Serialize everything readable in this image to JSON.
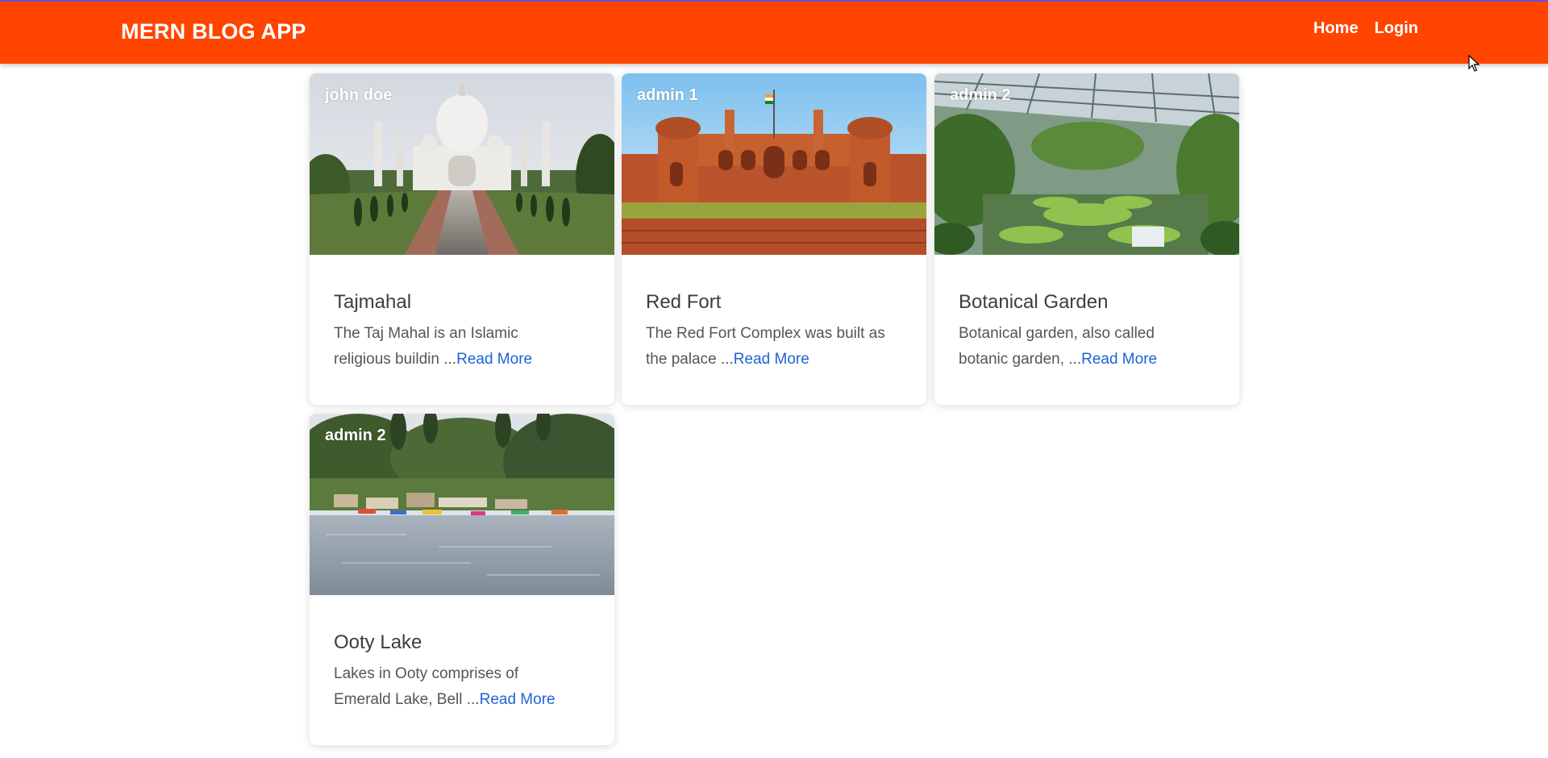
{
  "navbar": {
    "brand": "MERN BLOG APP",
    "links": [
      "Home",
      "Login"
    ],
    "background": "#ff4500"
  },
  "posts": [
    {
      "author": "john doe",
      "title": "Tajmahal",
      "excerpt_line1": "The Taj Mahal is an Islamic",
      "excerpt_line2": "religious buildin ...",
      "read_more": "Read More",
      "image": "taj-mahal-photo"
    },
    {
      "author": "admin 1",
      "title": "Red Fort",
      "excerpt_line1": "The Red Fort Complex was built as",
      "excerpt_line2": "the palace ...",
      "read_more": "Read More",
      "image": "red-fort-photo"
    },
    {
      "author": "admin 2",
      "title": "Botanical Garden",
      "excerpt_line1": "Botanical garden, also called",
      "excerpt_line2": "botanic garden, ...",
      "read_more": "Read More",
      "image": "botanical-garden-photo"
    },
    {
      "author": "admin 2",
      "title": "Ooty Lake",
      "excerpt_line1": "Lakes in Ooty comprises of",
      "excerpt_line2": "Emerald Lake, Bell ...",
      "read_more": "Read More",
      "image": "ooty-lake-photo"
    }
  ],
  "colors": {
    "link": "#1e63d6",
    "title": "#3d3d3d",
    "text": "#555555"
  }
}
